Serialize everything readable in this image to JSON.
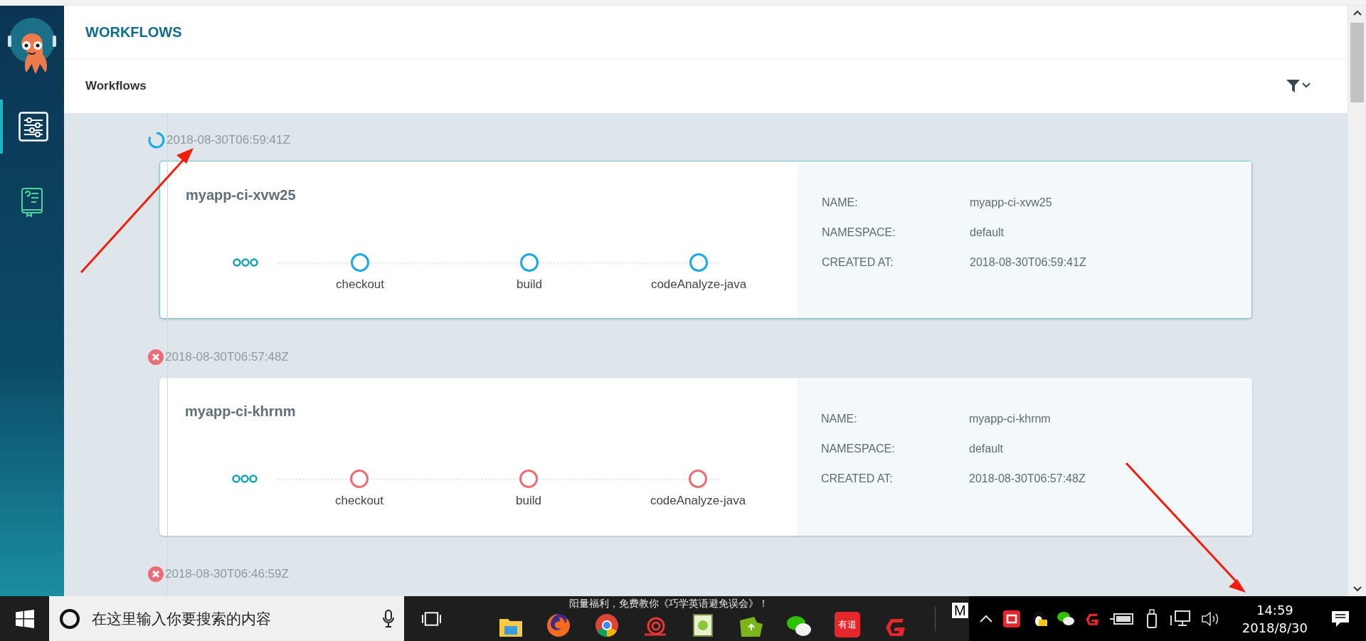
{
  "sidebar": {
    "items": [
      {
        "kind": "workflows",
        "selected": true
      },
      {
        "kind": "help",
        "selected": false
      }
    ]
  },
  "header": {
    "title": "WORKFLOWS"
  },
  "toolbar": {
    "title": "Workflows"
  },
  "workflows": [
    {
      "kind": "running",
      "timestamp": "2018-08-30T06:59:41Z",
      "name": "myapp-ci-xvw25",
      "steps": [
        "checkout",
        "build",
        "codeAnalyze-java"
      ],
      "details": [
        {
          "label": "NAME:",
          "value": "myapp-ci-xvw25"
        },
        {
          "label": "NAMESPACE:",
          "value": "default"
        },
        {
          "label": "CREATED AT:",
          "value": "2018-08-30T06:59:41Z"
        }
      ]
    },
    {
      "kind": "failed",
      "timestamp": "2018-08-30T06:57:48Z",
      "name": "myapp-ci-khrnm",
      "steps": [
        "checkout",
        "build",
        "codeAnalyze-java"
      ],
      "details": [
        {
          "label": "NAME:",
          "value": "myapp-ci-khrnm"
        },
        {
          "label": "NAMESPACE:",
          "value": "default"
        },
        {
          "label": "CREATED AT:",
          "value": "2018-08-30T06:57:48Z"
        }
      ]
    },
    {
      "kind": "failed",
      "timestamp": "2018-08-30T06:46:59Z"
    }
  ],
  "taskbar": {
    "search_placeholder": "在这里输入你要搜索的内容",
    "notification_text": "阳量福利，免费教你《巧学英语避免误会》！",
    "apps": [
      {
        "kind": "folder"
      },
      {
        "kind": "firefox"
      },
      {
        "kind": "chrome"
      },
      {
        "kind": "snail"
      },
      {
        "kind": "notepad"
      },
      {
        "kind": "greenfolder"
      },
      {
        "kind": "wechat"
      },
      {
        "kind": "youdao",
        "label": "有道"
      },
      {
        "kind": "redg"
      }
    ],
    "pinned_label": "M",
    "time": "14:59",
    "date": "2018/8/30"
  }
}
